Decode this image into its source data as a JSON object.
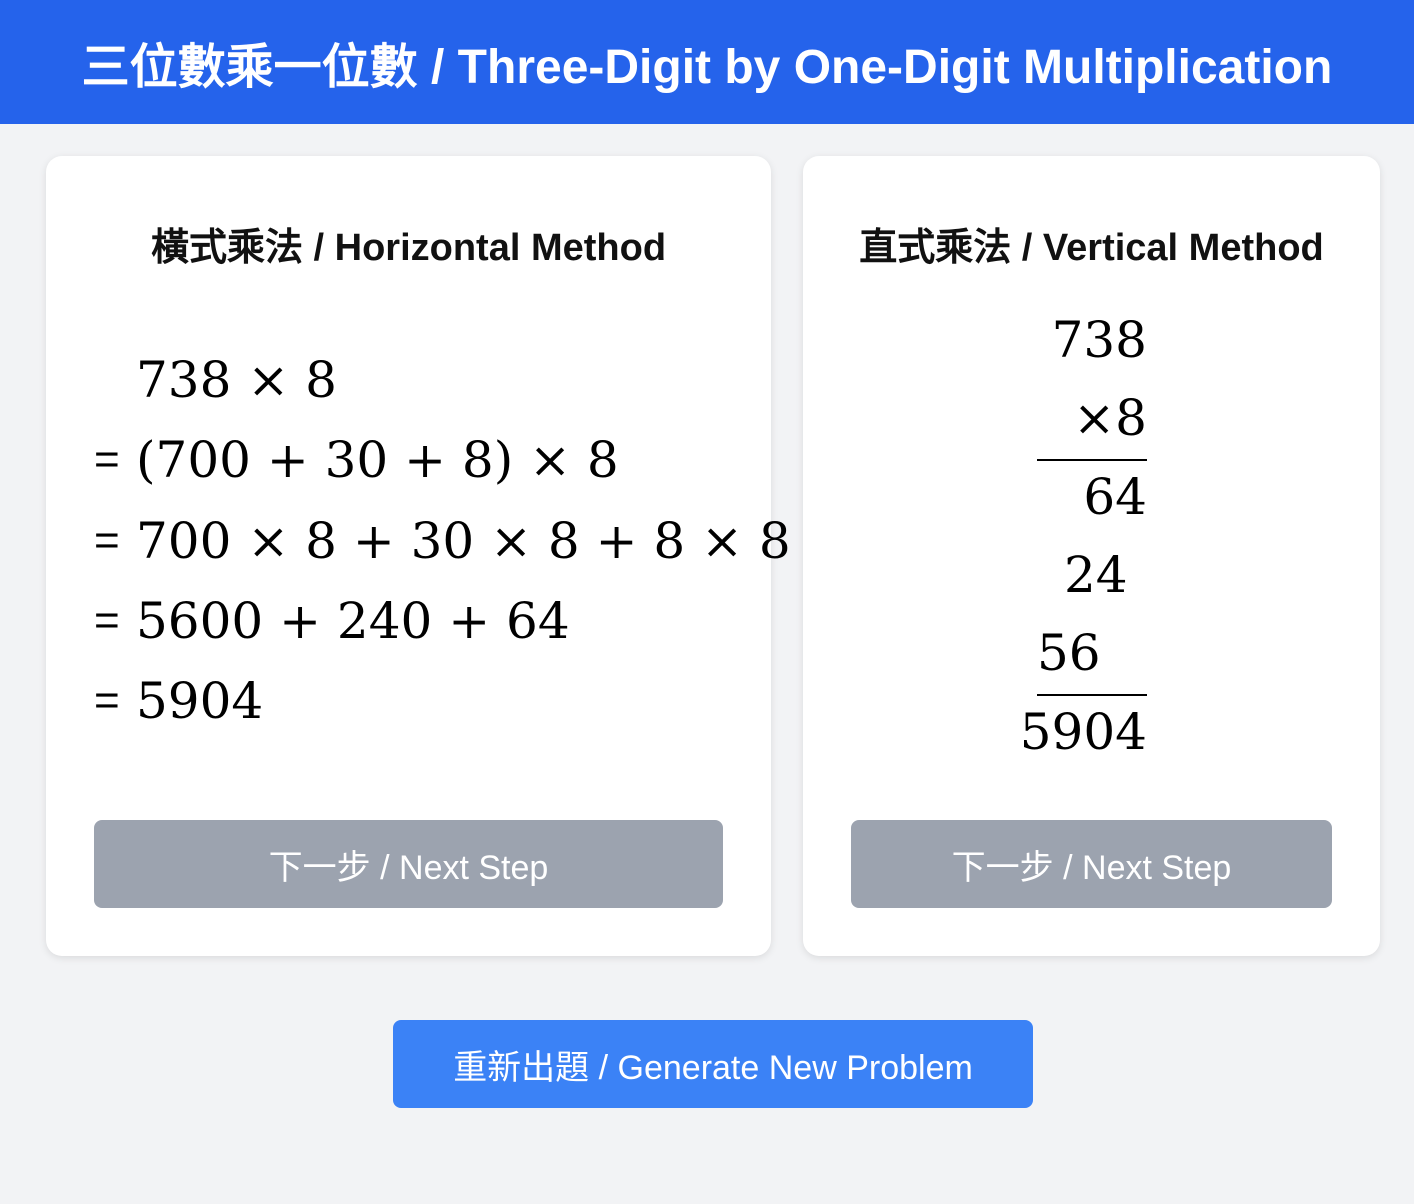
{
  "header": {
    "title": "三位數乘一位數 / Three-Digit by One-Digit Multiplication"
  },
  "horizontal": {
    "title": "橫式乘法 / Horizontal Method",
    "lines": [
      {
        "prefix": "",
        "expr": "738 × 8"
      },
      {
        "prefix": "=",
        "expr": "(700 + 30 + 8) × 8"
      },
      {
        "prefix": "=",
        "expr": "700 × 8 + 30 × 8 + 8 × 8"
      },
      {
        "prefix": "=",
        "expr": "5600 + 240 + 64"
      },
      {
        "prefix": "=",
        "expr": "5904"
      }
    ],
    "next_label": "下一步 / Next Step"
  },
  "vertical": {
    "title": "直式乘法 / Vertical Method",
    "multiplicand": "738",
    "multiplier": "×8",
    "partials": [
      "64",
      "24",
      "56"
    ],
    "result": "5904",
    "next_label": "下一步 / Next Step"
  },
  "actions": {
    "new_problem_label": "重新出題 / Generate New Problem"
  },
  "colors": {
    "header_bg": "#2563eb",
    "step_button": "#9ca3af",
    "primary_button": "#3b82f6",
    "page_bg": "#f2f3f5"
  }
}
